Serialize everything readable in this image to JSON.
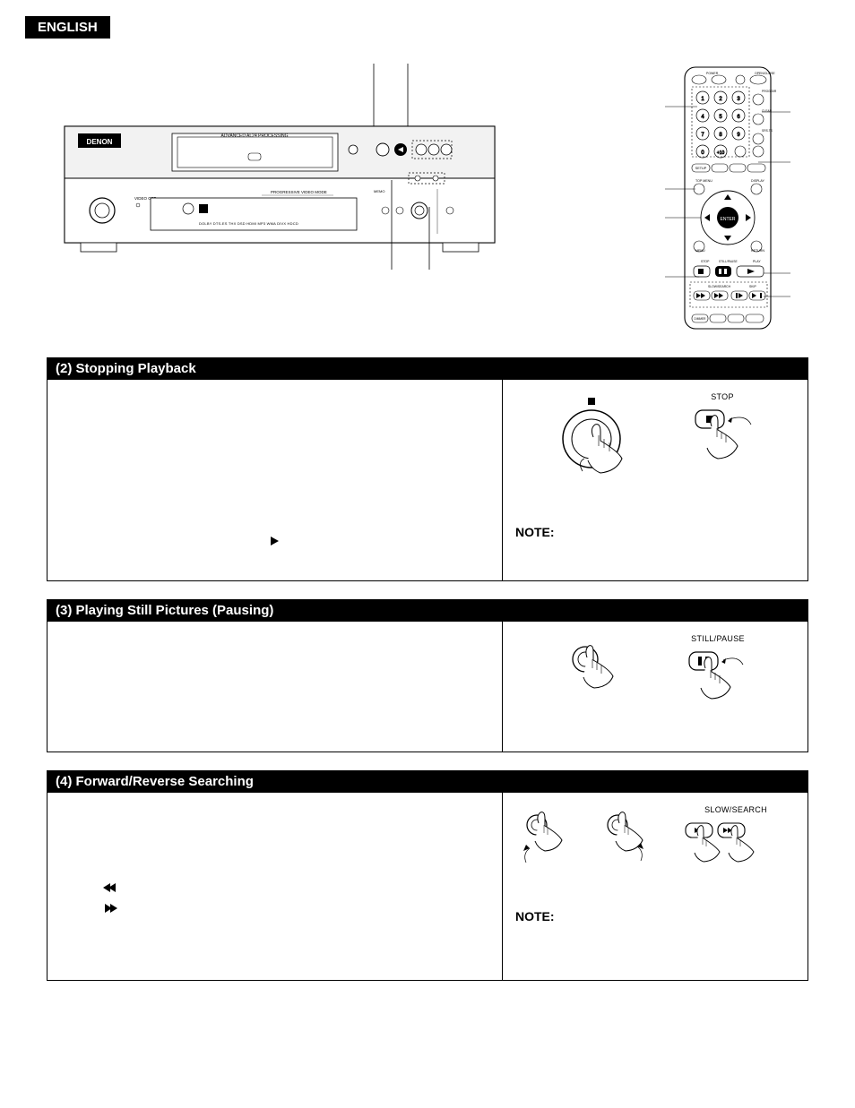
{
  "language_tab": "ENGLISH",
  "sections": {
    "s2": {
      "heading": "(2) Stopping Playback",
      "note_label": "NOTE:",
      "remote_btn_label": "STOP"
    },
    "s3": {
      "heading": "(3) Playing Still Pictures (Pausing)",
      "remote_btn_label": "STILL/PAUSE"
    },
    "s4": {
      "heading": "(4) Forward/Reverse Searching",
      "note_label": "NOTE:",
      "remote_btn_label": "SLOW/SEARCH"
    }
  }
}
